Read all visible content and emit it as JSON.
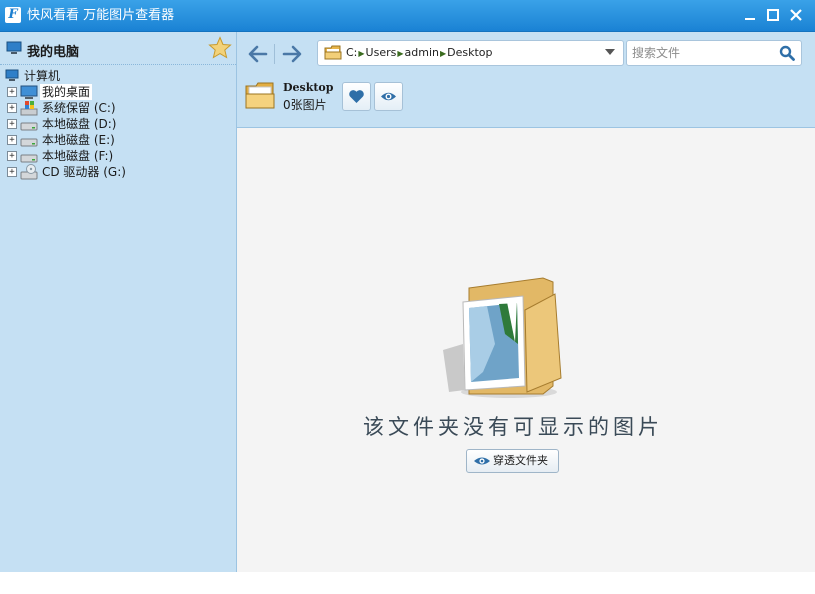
{
  "window": {
    "app_icon_letter": "F",
    "title": "快风看看 万能图片查看器"
  },
  "sidebar": {
    "title": "我的电脑",
    "root_label": "计算机",
    "items": [
      {
        "label": "我的桌面",
        "icon": "desktop-icon",
        "selected": true
      },
      {
        "label": "系统保留 (C:)",
        "icon": "windows-drive-icon"
      },
      {
        "label": "本地磁盘 (D:)",
        "icon": "drive-icon"
      },
      {
        "label": "本地磁盘 (E:)",
        "icon": "drive-icon"
      },
      {
        "label": "本地磁盘 (F:)",
        "icon": "drive-icon"
      },
      {
        "label": "CD 驱动器 (G:)",
        "icon": "cd-drive-icon"
      }
    ],
    "expander_symbol": "+"
  },
  "toolbar": {
    "breadcrumbs": [
      "C:",
      "Users",
      "admin",
      "Desktop"
    ],
    "search_placeholder": "搜索文件",
    "current_folder_name": "Desktop",
    "current_folder_count": "0张图片"
  },
  "content": {
    "empty_message": "该文件夹没有可显示的图片",
    "pierce_button_label": "穿透文件夹"
  },
  "colors": {
    "titlebar": "#1a82d4",
    "panel": "#c5e0f3",
    "accent_icon": "#2f6fa8"
  }
}
